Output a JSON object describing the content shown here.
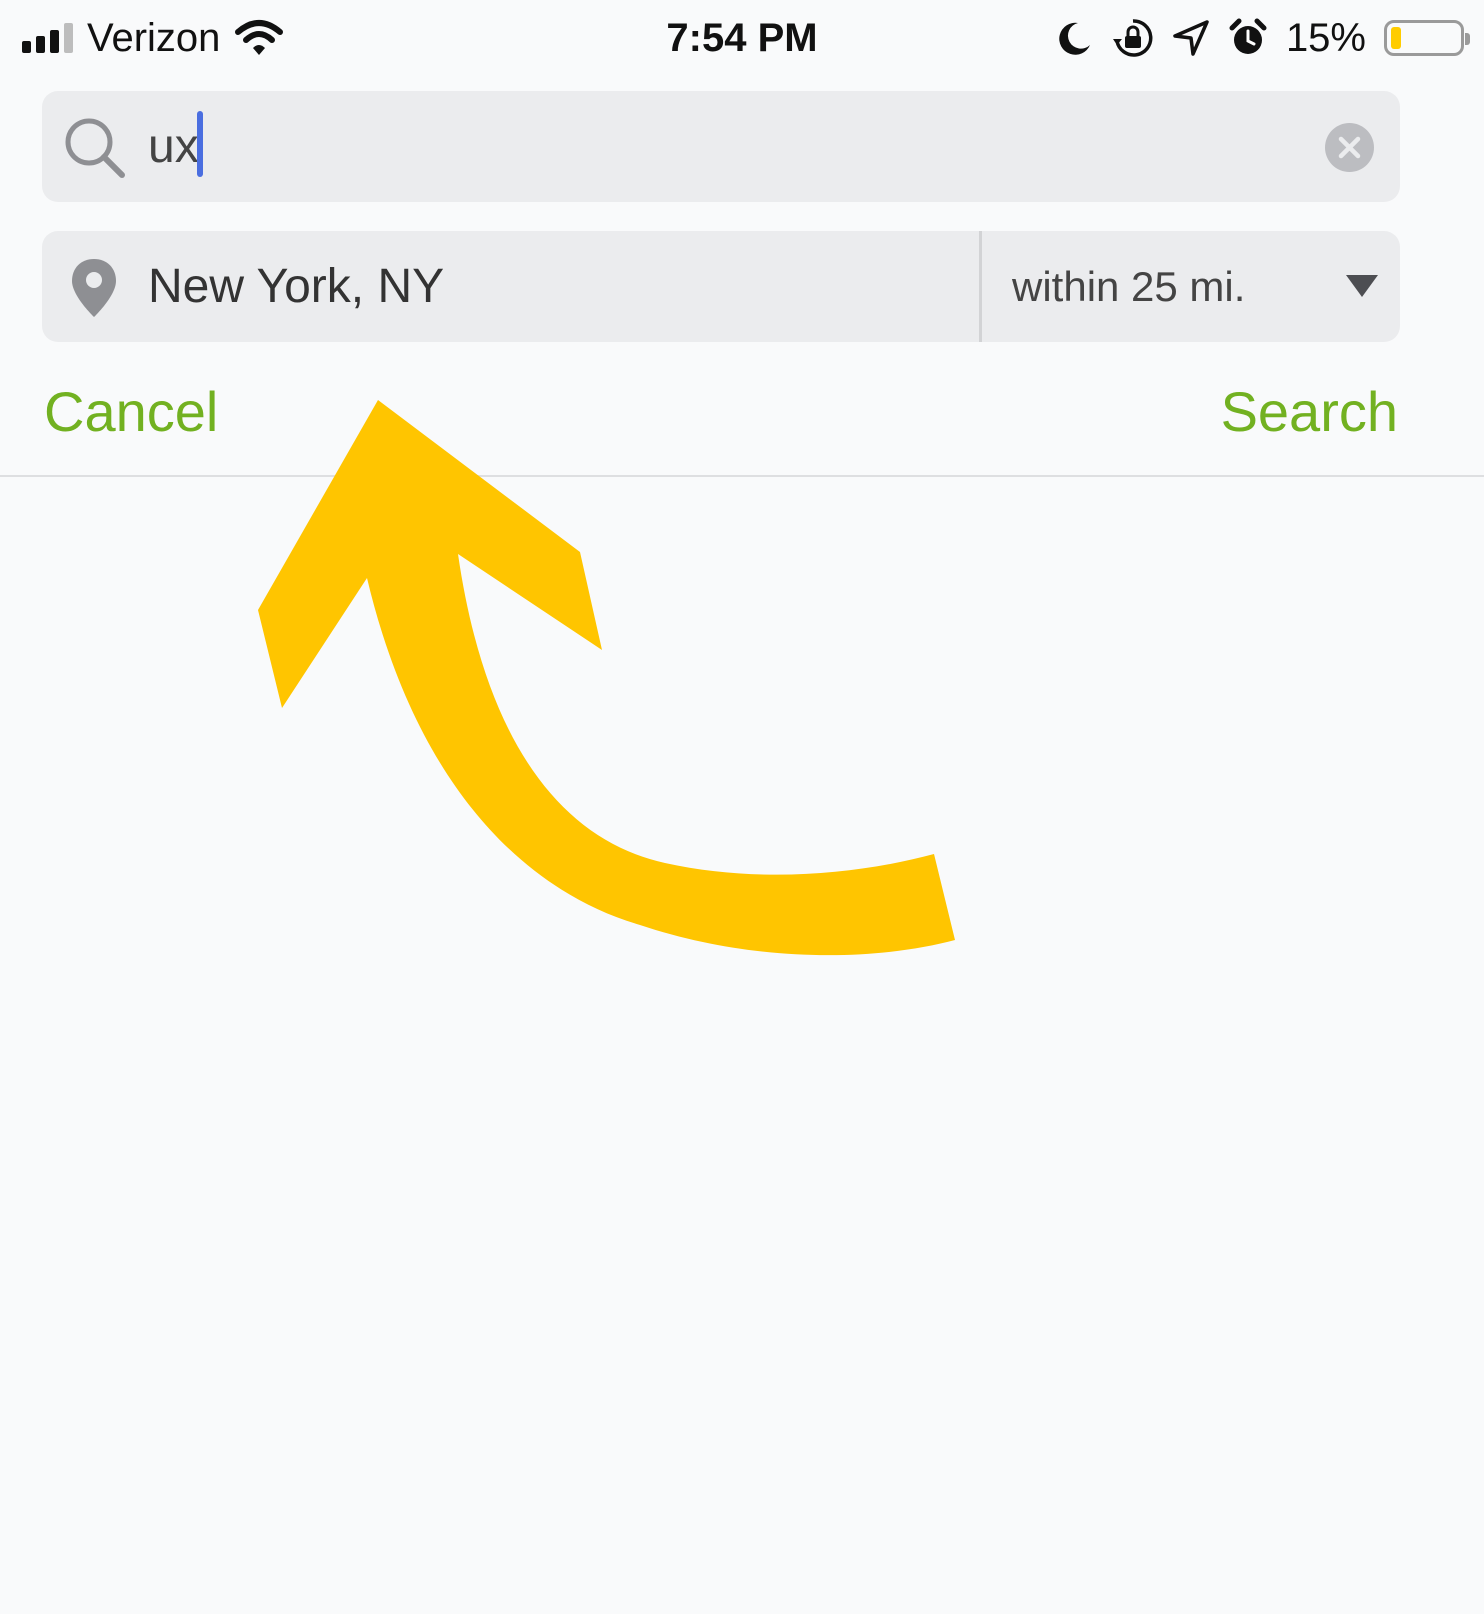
{
  "status_bar": {
    "carrier": "Verizon",
    "time": "7:54 PM",
    "battery_percent": "15%",
    "battery_level": 0.15,
    "icons": [
      "signal-icon",
      "wifi-icon",
      "moon-icon",
      "orientation-lock-icon",
      "location-arrow-icon",
      "alarm-icon",
      "battery-icon"
    ]
  },
  "search": {
    "value": "ux"
  },
  "location": {
    "value": "New York, NY",
    "radius": "within 25 mi."
  },
  "actions": {
    "cancel_label": "Cancel",
    "search_label": "Search"
  },
  "colors": {
    "accent": "#72b121",
    "arrow": "#ffc500",
    "caret": "#4a6ee0",
    "field_bg": "#ebecee",
    "page_bg": "#f9fafb"
  }
}
